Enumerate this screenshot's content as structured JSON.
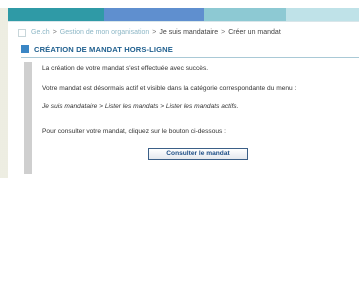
{
  "breadcrumb": {
    "items": [
      "Ge.ch",
      "Gestion de mon organisation",
      "Je suis mandataire"
    ],
    "separator": ">",
    "current": "Créer un mandat"
  },
  "page": {
    "title": "CRÉATION DE MANDAT HORS-LIGNE"
  },
  "content": {
    "line1": "La création de votre mandat s'est effectuée avec succès.",
    "line2": "Votre mandat est désormais actif et visible dans la catégorie correspondante du menu :",
    "line3": "Je suis mandataire > Lister les mandats > Lister les mandats actifs.",
    "line4": "Pour consulter votre mandat, cliquez sur le bouton ci-dessous :"
  },
  "actions": {
    "consult_label": "Consulter le mandat"
  },
  "colors": {
    "banner": [
      "#2f9aa6",
      "#5f8fcf",
      "#8dc9d3",
      "#bfe2e8"
    ],
    "title_square": "#3a86c5",
    "title_text": "#1f5f8e",
    "breadcrumb_link": "#8db7c6"
  }
}
